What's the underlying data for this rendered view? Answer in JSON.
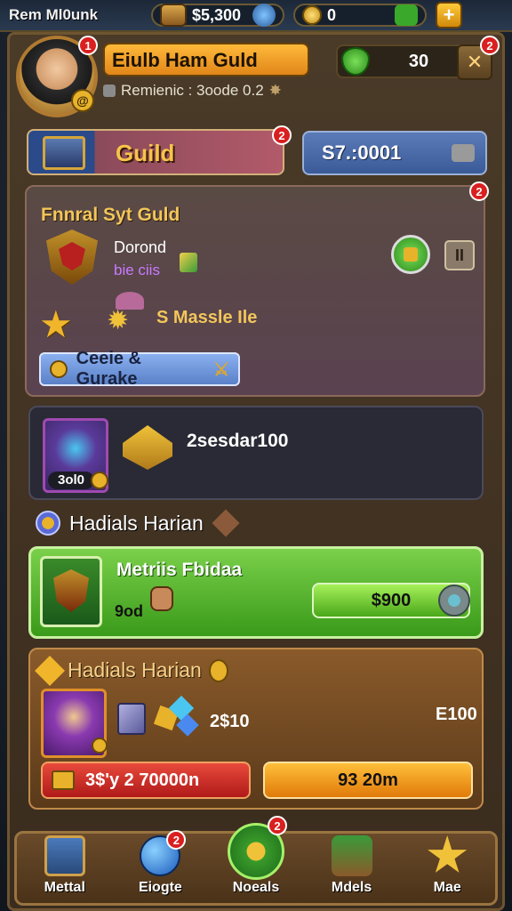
{
  "topbar": {
    "title": "Rem Ml0unk",
    "gold": "$5,300",
    "coins": "0",
    "plus_label": "+"
  },
  "profile": {
    "guild_name": "Eiulb Ham Guld",
    "status": "Remienic : 3oode 0.2",
    "shield_value": "30",
    "avatar_badge": "1",
    "close_badge": "2"
  },
  "tabs": {
    "guild_label": "Guild",
    "guild_badge": "2",
    "currency": "S7.:0001"
  },
  "panel1": {
    "title": "Fnnral Syt Guld",
    "badge": "2",
    "name": "Dorond",
    "sub": "bie ciis",
    "reward": "S  Massle Ile",
    "pause_label": "II",
    "button_label": "Ceeie & Gurake"
  },
  "panel2": {
    "count": "3ol0",
    "text": "2sesdar100"
  },
  "section": {
    "label": "Hadials Harian"
  },
  "panel3": {
    "title": "Metriis Fbidaa",
    "sub": "9od",
    "button_label": "$900"
  },
  "panel4": {
    "label": "Hadials Harian",
    "num": "2$10",
    "right_val": "E100",
    "red_button": "3$'y 2 70000n",
    "orange_button": "93 20m"
  },
  "nav": {
    "items": [
      {
        "label": "Mettal"
      },
      {
        "label": "Eiogte",
        "badge": "2"
      },
      {
        "label": "Noeals",
        "badge": "2"
      },
      {
        "label": "Mdels"
      },
      {
        "label": "Mae"
      }
    ]
  }
}
